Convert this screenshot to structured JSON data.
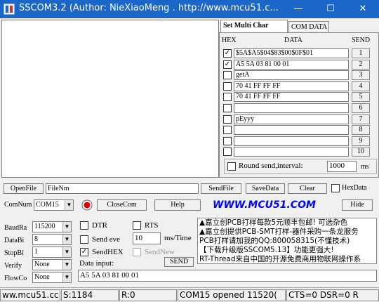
{
  "titlebar": {
    "title": "SSCOM3.2 (Author: NieXiaoMeng .  http://www.mcu51.c...",
    "minimize": "—",
    "maximize": "☐",
    "close": "✕"
  },
  "tabs": {
    "multi_char": "Set Multi Char",
    "com_data": "COM DATA"
  },
  "multi": {
    "hex_header": "HEX",
    "data_header": "DATA",
    "send_header": "SEND",
    "rows": [
      {
        "checked": true,
        "data": "$5A$A5$04$83$00$0F$01",
        "send": "1"
      },
      {
        "checked": true,
        "data": "A5 5A 03 81 00 01",
        "send": "2"
      },
      {
        "checked": false,
        "data": "getA",
        "send": "3"
      },
      {
        "checked": false,
        "data": "70 41 FF FF FF",
        "send": "4"
      },
      {
        "checked": false,
        "data": "70 41 FF FF FF",
        "send": "5"
      },
      {
        "checked": false,
        "data": "",
        "send": "6"
      },
      {
        "checked": false,
        "data": "pEyyy",
        "send": "7"
      },
      {
        "checked": false,
        "data": "",
        "send": "8"
      },
      {
        "checked": false,
        "data": "",
        "send": "9"
      },
      {
        "checked": false,
        "data": "",
        "send": "10"
      }
    ],
    "round_label": "Round send,interval:",
    "interval_value": "1000",
    "interval_unit": "ms"
  },
  "row1": {
    "openfile": "OpenFile",
    "filename": "FileNm",
    "sendfile": "SendFile",
    "savedata": "SaveData",
    "clear": "Clear",
    "hexdata": "HexData"
  },
  "row2": {
    "comnum_label": "ComNum",
    "com_value": "COM15",
    "closecom": "CloseCom",
    "help": "Help",
    "logo": "WWW.MCU51.COM",
    "hide": "Hide"
  },
  "settings": {
    "baud_label": "BaudRa",
    "baud_value": "115200",
    "data_label": "DataBi",
    "data_value": "8",
    "stop_label": "StopBi",
    "stop_value": "1",
    "verify_label": "Verify",
    "verify_value": "None",
    "flow_label": "FlowCo",
    "flow_value": "None",
    "dtr": "DTR",
    "rts": "RTS",
    "send_every": "Send eve",
    "send_every_value": "10",
    "ms_time": "ms/Time",
    "sendhex": "SendHEX",
    "sendnew": "SendNew",
    "data_input_label": "Data input:",
    "send_button": "SEND",
    "data_input_value": "A5 5A 03 81 00 01"
  },
  "info": [
    "▲嘉立创PCB打样每款5元顺丰包邮! 可选杂色",
    "▲嘉立创提供PCB-SMT打样-器件采购一条龙服务",
    "PCB打样请加我的QQ:800058315(不懂技术)",
    "【下载升级版SSCOM5.13】功能更强大!",
    "RT-Thread来自中国的开源免费商用物联网操作系"
  ],
  "status": {
    "site": "ww.mcu51.cc",
    "sent": "S:1184",
    "received": "R:0",
    "port": "COM15 opened 11520(",
    "lines": "CTS=0 DSR=0 R"
  }
}
